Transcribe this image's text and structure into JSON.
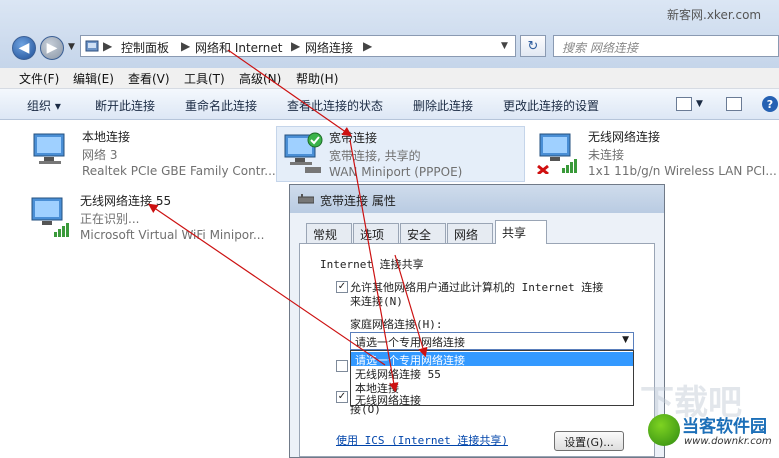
{
  "watermark_top": "新客网.xker.com",
  "address": {
    "breadcrumbs": [
      "控制面板",
      "网络和 Internet",
      "网络连接"
    ],
    "search_placeholder": "搜索 网络连接"
  },
  "menu": [
    "文件(F)",
    "编辑(E)",
    "查看(V)",
    "工具(T)",
    "高级(N)",
    "帮助(H)"
  ],
  "toolbar": {
    "organize": "组织",
    "commands": [
      "断开此连接",
      "重命名此连接",
      "查看此连接的状态",
      "删除此连接",
      "更改此连接的设置"
    ]
  },
  "connections": [
    {
      "name": "本地连接",
      "status": "网络  3",
      "device": "Realtek PCIe GBE Family Contr..."
    },
    {
      "name": "宽带连接",
      "status": "宽带连接, 共享的",
      "device": "WAN Miniport (PPPOE)"
    },
    {
      "name": "无线网络连接",
      "status": "未连接",
      "device": "1x1 11b/g/n Wireless LAN PCI..."
    },
    {
      "name": "无线网络连接 55",
      "status": "正在识别...",
      "device": "Microsoft Virtual WiFi Minipor..."
    }
  ],
  "dialog": {
    "title": "宽带连接 属性",
    "tabs": [
      "常规",
      "选项",
      "安全",
      "网络",
      "共享"
    ],
    "section": "Internet 连接共享",
    "allow_line1": "允许其他网络用户通过此计算机的 Internet 连接",
    "allow_line2": "来连接(N)",
    "home_label": "家庭网络连接(H):",
    "combo_value": "请选一个专用网络连接",
    "dropdown_options": [
      "请选一个专用网络连接",
      "无线网络连接 55",
      "本地连接",
      "无线网络连接"
    ],
    "check2_tail": "接(O)",
    "ics_link": "使用 ICS (Internet 连接共享)",
    "settings_button": "设置(G)..."
  },
  "logo": {
    "brand": "当客软件园",
    "url": "www.downkr.com"
  },
  "colors": {
    "accent": "#3399ff",
    "arrow": "#cc1111"
  }
}
